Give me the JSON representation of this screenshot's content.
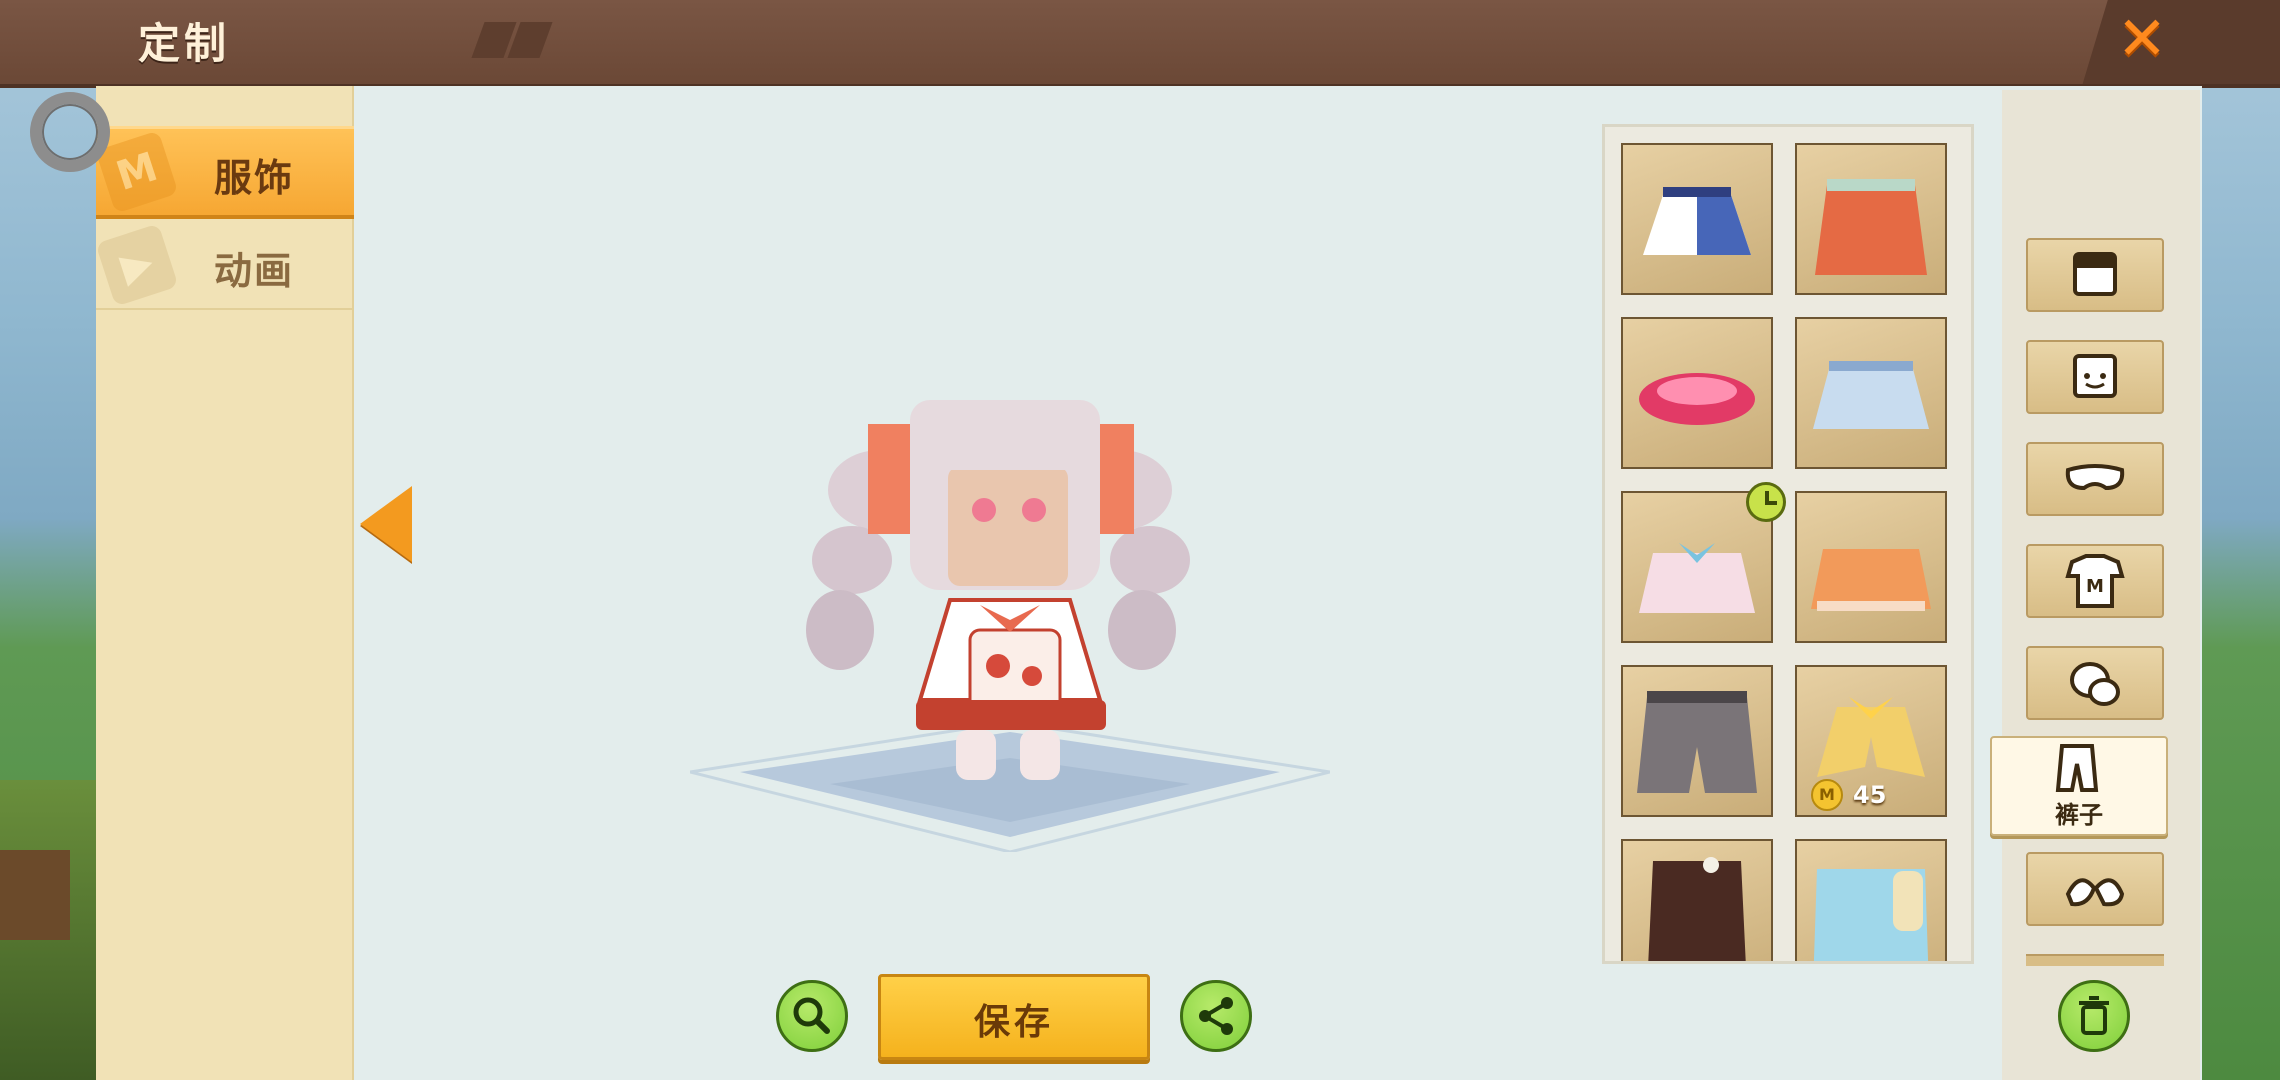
{
  "header": {
    "title": "定制",
    "close_icon": "close-x-icon"
  },
  "sidebar": {
    "tabs": [
      {
        "label": "服饰",
        "icon": "shirt-m-icon",
        "active": true
      },
      {
        "label": "动画",
        "icon": "play-icon",
        "active": false
      }
    ]
  },
  "items": [
    {
      "name": "plaid-white-skirt"
    },
    {
      "name": "orange-ruffle-skirt"
    },
    {
      "name": "pink-ruffle-skirt"
    },
    {
      "name": "blue-plaid-skirt"
    },
    {
      "name": "blue-bow-skirt",
      "timed": true
    },
    {
      "name": "orange-bow-skirt"
    },
    {
      "name": "gray-shorts"
    },
    {
      "name": "gold-ribbon-pants",
      "price": "45"
    },
    {
      "name": "brown-pants"
    },
    {
      "name": "cyan-scroll-pants"
    }
  ],
  "categories": [
    {
      "icon": "hair-icon"
    },
    {
      "icon": "face-icon"
    },
    {
      "icon": "mask-icon"
    },
    {
      "icon": "shirt-icon"
    },
    {
      "icon": "gloves-icon"
    },
    {
      "icon": "pants-icon",
      "label": "裤子",
      "active": true
    },
    {
      "icon": "shoes-icon"
    }
  ],
  "actions": {
    "save_label": "保存",
    "zoom_icon": "magnifier-icon",
    "share_icon": "share-icon",
    "delete_icon": "trash-icon"
  },
  "colors": {
    "accent": "#f5b21d",
    "header": "#6b4836",
    "green_button": "#7fcf3a"
  }
}
